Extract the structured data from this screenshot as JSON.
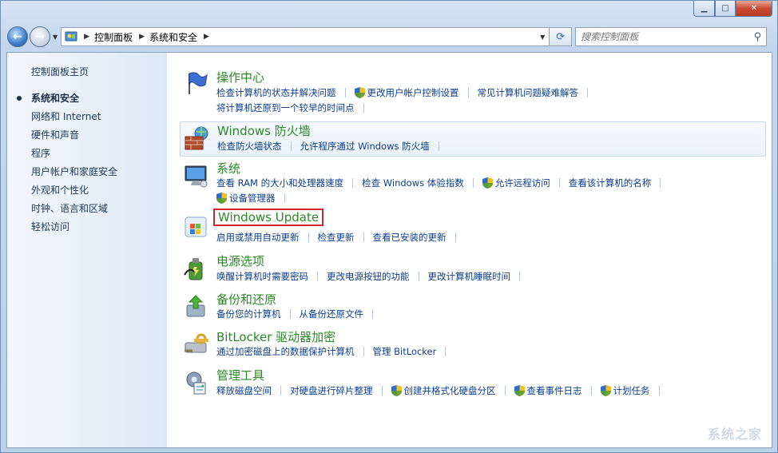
{
  "window": {
    "caption": {
      "minimize": "▁",
      "maximize": "□",
      "close": "✕"
    }
  },
  "nav": {
    "back_glyph": "←",
    "forward_glyph": "→",
    "breadcrumbs": [
      "控制面板",
      "系统和安全"
    ],
    "search_placeholder": "搜索控制面板"
  },
  "sidebar": {
    "items": [
      {
        "label": "控制面板主页"
      },
      {
        "label": "系统和安全",
        "selected": true
      },
      {
        "label": "网络和 Internet"
      },
      {
        "label": "硬件和声音"
      },
      {
        "label": "程序"
      },
      {
        "label": "用户帐户和家庭安全"
      },
      {
        "label": "外观和个性化"
      },
      {
        "label": "时钟、语言和区域"
      },
      {
        "label": "轻松访问"
      }
    ]
  },
  "categories": [
    {
      "title": "操作中心",
      "icon": "flag-icon",
      "rows": [
        [
          "检查计算机的状态并解决问题",
          "更改用户帐户控制设置",
          "常见计算机问题疑难解答"
        ],
        [
          "将计算机还原到一个较早的时间点"
        ]
      ]
    },
    {
      "title": "Windows 防火墙",
      "icon": "firewall-icon",
      "rows": [
        [
          "检查防火墙状态",
          "允许程序通过 Windows 防火墙"
        ]
      ]
    },
    {
      "title": "系统",
      "icon": "system-icon",
      "rows": [
        [
          "查看 RAM 的大小和处理器速度",
          "检查 Windows 体验指数",
          "允许远程访问",
          "查看该计算机的名称"
        ],
        [
          "设备管理器"
        ]
      ]
    },
    {
      "title": "Windows Update",
      "icon": "windows-update-icon",
      "rows": [
        [
          "启用或禁用自动更新",
          "检查更新",
          "查看已安装的更新"
        ]
      ]
    },
    {
      "title": "电源选项",
      "icon": "power-icon",
      "rows": [
        [
          "唤醒计算机时需要密码",
          "更改电源按钮的功能",
          "更改计算机睡眠时间"
        ]
      ]
    },
    {
      "title": "备份和还原",
      "icon": "backup-icon",
      "rows": [
        [
          "备份您的计算机",
          "从备份还原文件"
        ]
      ]
    },
    {
      "title": "BitLocker 驱动器加密",
      "icon": "bitlocker-icon",
      "rows": [
        [
          "通过加密磁盘上的数据保护计算机",
          "管理 BitLocker"
        ]
      ]
    },
    {
      "title": "管理工具",
      "icon": "admin-tools-icon",
      "rows": [
        [
          "释放磁盘空间",
          "对硬盘进行碎片整理",
          "创建并格式化硬盘分区",
          "查看事件日志",
          "计划任务"
        ]
      ]
    }
  ],
  "colors": {
    "accent_green": "#2a8a26",
    "link_blue": "#0b3e8e",
    "highlight_border": "#d2262c"
  },
  "watermark": "系统之家"
}
